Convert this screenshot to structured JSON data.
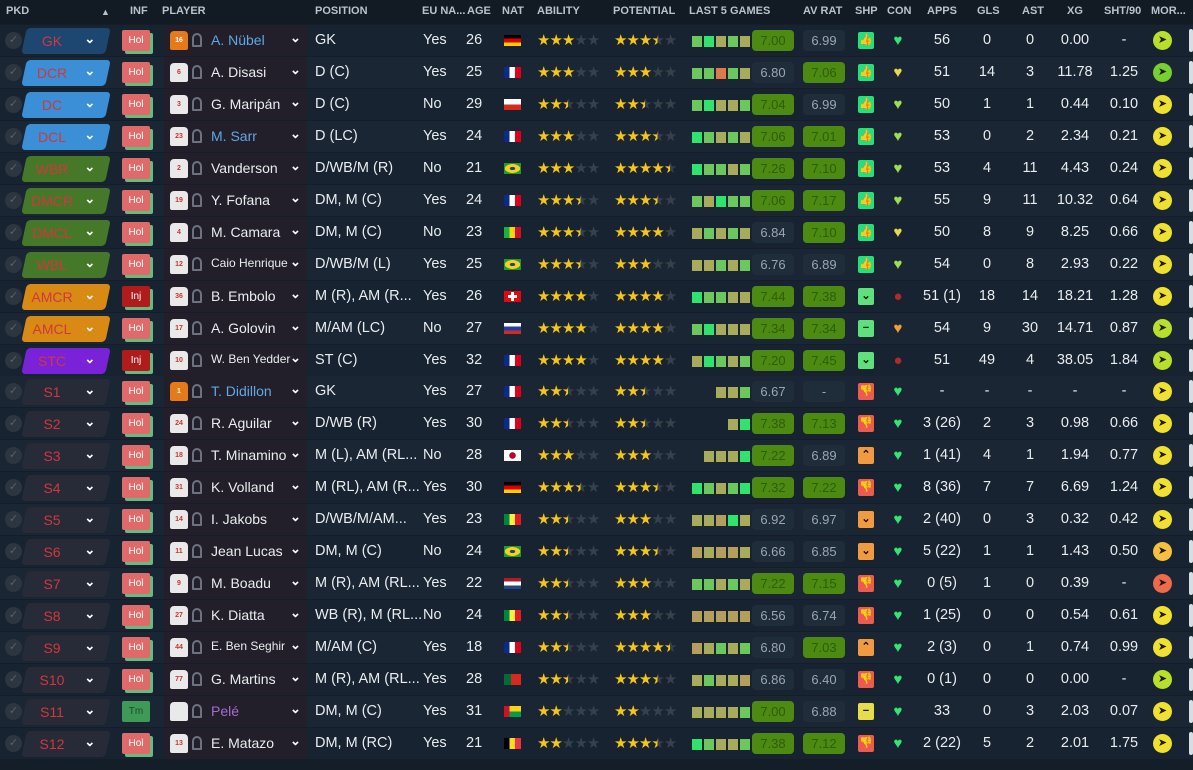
{
  "header": {
    "pkd": "PKD",
    "sort": "▲",
    "inf": "INF",
    "player": "PLAYER",
    "position": "POSITION",
    "eu": "EU NA...",
    "age": "AGE",
    "nat": "NAT",
    "ability": "ABILITY",
    "potential": "POTENTIAL",
    "last5": "LAST 5 GAMES",
    "avrat": "AV RAT",
    "shp": "SHP",
    "con": "CON",
    "apps": "APPS",
    "gls": "GLS",
    "ast": "AST",
    "xg": "XG",
    "sht90": "SHT/90",
    "mor": "MOR..."
  },
  "colors": {
    "gk": "#1d4670",
    "def": "#3a8fd6",
    "mid": "#46782a",
    "att": "#d88a14",
    "st": "#7a22d8",
    "sub": "#262b37",
    "hol": "#e06a6a",
    "inj": "#b01c1c",
    "tm": "#3f9a58",
    "name_default": "#e8ecef",
    "name_blue": "#5fa8e6",
    "name_purple": "#a56ad2"
  },
  "players": [
    {
      "pos": "GK",
      "pc": "gk",
      "inf": "Hol",
      "no": "16",
      "keeper": true,
      "name": "A. Nübel",
      "nc": "name_blue",
      "position": "GK",
      "eu": "Yes",
      "age": "26",
      "nat": "de",
      "ability": 3,
      "potential": 3.5,
      "last5": [
        "L",
        "G",
        "O",
        "L",
        "O"
      ],
      "form": "7.00",
      "avrat": "6.99",
      "shp": "thumb-up",
      "con": "green",
      "apps": "56",
      "gls": "0",
      "ast": "0",
      "xg": "0.00",
      "sht90": "-",
      "mor": "lime"
    },
    {
      "pos": "DCR",
      "pc": "def",
      "inf": "Hol",
      "no": "6",
      "name": "A. Disasi",
      "position": "D (C)",
      "eu": "Yes",
      "age": "25",
      "nat": "fr",
      "ability": 3,
      "potential": 3,
      "last5": [
        "L",
        "L",
        "R",
        "L",
        "O"
      ],
      "form": "6.80",
      "avrat": "7.06",
      "shp": "thumb-up",
      "con": "yellow",
      "apps": "51",
      "gls": "14",
      "ast": "3",
      "xg": "11.78",
      "sht90": "1.25",
      "mor": "green"
    },
    {
      "pos": "DC",
      "pc": "def",
      "inf": "Hol",
      "no": "3",
      "name": "G. Maripán",
      "position": "D (C)",
      "eu": "No",
      "age": "29",
      "nat": "cl",
      "ability": 2.5,
      "potential": 2.5,
      "last5": [
        "L",
        "G",
        "O",
        "O",
        "L"
      ],
      "form": "7.04",
      "avrat": "6.99",
      "shp": "thumb-up",
      "con": "lime",
      "apps": "50",
      "gls": "1",
      "ast": "1",
      "xg": "0.44",
      "sht90": "0.10",
      "mor": "yellow"
    },
    {
      "pos": "DCL",
      "pc": "def",
      "inf": "Hol",
      "no": "23",
      "name": "M. Sarr",
      "nc": "name_blue",
      "position": "D (LC)",
      "eu": "Yes",
      "age": "24",
      "nat": "fr",
      "ability": 3,
      "potential": 3.5,
      "last5": [
        "G",
        "L",
        "O",
        "L",
        "O"
      ],
      "form": "7.06",
      "avrat": "7.01",
      "shp": "thumb-up",
      "con": "lime",
      "apps": "53",
      "gls": "0",
      "ast": "2",
      "xg": "2.34",
      "sht90": "0.21",
      "mor": "yellow"
    },
    {
      "pos": "WBR",
      "pc": "mid",
      "inf": "Hol",
      "no": "2",
      "name": "Vanderson",
      "position": "D/WB/M (R)",
      "eu": "No",
      "age": "21",
      "nat": "br",
      "ability": 3,
      "potential": 4.5,
      "last5": [
        "G",
        "L",
        "L",
        "O",
        "L"
      ],
      "form": "7.26",
      "avrat": "7.10",
      "shp": "thumb-up",
      "con": "lime",
      "apps": "53",
      "gls": "4",
      "ast": "11",
      "xg": "4.43",
      "sht90": "0.24",
      "mor": "yellow"
    },
    {
      "pos": "DMCR",
      "pc": "mid",
      "inf": "Hol",
      "no": "19",
      "name": "Y. Fofana",
      "position": "DM, M (C)",
      "eu": "Yes",
      "age": "24",
      "nat": "fr",
      "ability": 3.5,
      "potential": 3.5,
      "last5": [
        "L",
        "O",
        "G",
        "L",
        "L"
      ],
      "form": "7.06",
      "avrat": "7.17",
      "shp": "thumb-up",
      "con": "lime",
      "apps": "55",
      "gls": "9",
      "ast": "11",
      "xg": "10.32",
      "sht90": "0.64",
      "mor": "yellow"
    },
    {
      "pos": "DMCL",
      "pc": "mid",
      "inf": "Hol",
      "no": "4",
      "name": "M. Camara",
      "position": "DM, M (C)",
      "eu": "No",
      "age": "23",
      "nat": "ml",
      "ability": 3.5,
      "potential": 4,
      "last5": [
        "O",
        "L",
        "O",
        "L",
        "O"
      ],
      "form": "6.84",
      "avrat": "7.10",
      "shp": "thumb-up",
      "con": "yellow",
      "apps": "50",
      "gls": "8",
      "ast": "9",
      "xg": "8.25",
      "sht90": "0.66",
      "mor": "yellow"
    },
    {
      "pos": "WBL",
      "pc": "mid",
      "inf": "Hol",
      "no": "12",
      "name": "Caio Henrique",
      "position": "D/WB/M (L)",
      "eu": "Yes",
      "age": "25",
      "nat": "br",
      "ability": 3.5,
      "potential": 3,
      "last5": [
        "O",
        "O",
        "L",
        "O",
        "L"
      ],
      "form": "6.76",
      "avrat": "6.89",
      "shp": "thumb-up",
      "con": "lime",
      "apps": "54",
      "gls": "0",
      "ast": "8",
      "xg": "2.93",
      "sht90": "0.22",
      "mor": "yellow"
    },
    {
      "pos": "AMCR",
      "pc": "att",
      "inf": "Inj",
      "no": "36",
      "name": "B. Embolo",
      "position": "M (R), AM (R...",
      "eu": "Yes",
      "age": "26",
      "nat": "ch",
      "ability": 4,
      "potential": 4,
      "last5": [
        "G",
        "L",
        "L",
        "O",
        "O"
      ],
      "form": "7.44",
      "avrat": "7.38",
      "shp": "chevron-down",
      "con": "injury",
      "apps": "51 (1)",
      "gls": "18",
      "ast": "14",
      "xg": "18.21",
      "sht90": "1.28",
      "mor": "yellow"
    },
    {
      "pos": "AMCL",
      "pc": "att",
      "inf": "Hol",
      "no": "17",
      "name": "A. Golovin",
      "position": "M/AM (LC)",
      "eu": "No",
      "age": "27",
      "nat": "ru",
      "ability": 4,
      "potential": 4,
      "last5": [
        "L",
        "G",
        "O",
        "O",
        "O"
      ],
      "form": "7.34",
      "avrat": "7.34",
      "shp": "minus",
      "con": "orange",
      "apps": "54",
      "gls": "9",
      "ast": "30",
      "xg": "14.71",
      "sht90": "0.87",
      "mor": "lime"
    },
    {
      "pos": "STC",
      "pc": "st",
      "inf": "Inj",
      "no": "10",
      "name": "W. Ben Yedder",
      "position": "ST (C)",
      "eu": "Yes",
      "age": "32",
      "nat": "fr",
      "ability": 4,
      "potential": 4,
      "last5": [
        "O",
        "G",
        "L",
        "O",
        "L"
      ],
      "form": "7.20",
      "avrat": "7.45",
      "shp": "chevron-down",
      "con": "injury",
      "apps": "51",
      "gls": "49",
      "ast": "4",
      "xg": "38.05",
      "sht90": "1.84",
      "mor": "lime"
    },
    {
      "pos": "S1",
      "pc": "sub",
      "inf": "Hol",
      "no": "1",
      "keeper": true,
      "name": "T. Didillon",
      "nc": "name_blue",
      "position": "GK",
      "eu": "Yes",
      "age": "27",
      "nat": "fr",
      "ability": 2.5,
      "potential": 2.5,
      "last5": [
        "",
        "",
        "O",
        "O",
        "L"
      ],
      "form": "6.67",
      "avrat": "-",
      "shp": "thumb-down",
      "con": "green",
      "apps": "-",
      "gls": "-",
      "ast": "-",
      "xg": "-",
      "sht90": "-",
      "mor": "yellow"
    },
    {
      "pos": "S2",
      "pc": "sub",
      "inf": "Hol",
      "no": "24",
      "name": "R. Aguilar",
      "position": "D/WB (R)",
      "eu": "Yes",
      "age": "30",
      "nat": "fr",
      "ability": 2.5,
      "potential": 2.5,
      "last5": [
        "",
        "",
        "",
        "O",
        "G"
      ],
      "form": "7.38",
      "avrat": "7.13",
      "shp": "thumb-down",
      "con": "green",
      "apps": "3 (26)",
      "gls": "2",
      "ast": "3",
      "xg": "0.98",
      "sht90": "0.66",
      "mor": "yellow"
    },
    {
      "pos": "S3",
      "pc": "sub",
      "inf": "Hol",
      "no": "18",
      "name": "T. Minamino",
      "position": "M (L), AM (RL...",
      "eu": "No",
      "age": "28",
      "nat": "jp",
      "ability": 3,
      "potential": 3,
      "last5": [
        "",
        "O",
        "O",
        "O",
        "G"
      ],
      "form": "7.22",
      "avrat": "6.89",
      "shp": "chevron-up",
      "con": "green",
      "apps": "1 (41)",
      "gls": "4",
      "ast": "1",
      "xg": "1.94",
      "sht90": "0.77",
      "mor": "yellow"
    },
    {
      "pos": "S4",
      "pc": "sub",
      "inf": "Hol",
      "no": "31",
      "name": "K. Volland",
      "position": "M (RL), AM (R...",
      "eu": "Yes",
      "age": "30",
      "nat": "de",
      "ability": 3.5,
      "potential": 3.5,
      "last5": [
        "G",
        "L",
        "O",
        "L",
        "G"
      ],
      "form": "7.32",
      "avrat": "7.22",
      "shp": "thumb-down",
      "con": "green",
      "apps": "8 (36)",
      "gls": "7",
      "ast": "7",
      "xg": "6.69",
      "sht90": "1.24",
      "mor": "yellow"
    },
    {
      "pos": "S5",
      "pc": "sub",
      "inf": "Hol",
      "no": "14",
      "name": "I. Jakobs",
      "position": "D/WB/M/AM...",
      "eu": "Yes",
      "age": "23",
      "nat": "sn",
      "ability": 2.5,
      "potential": 3,
      "last5": [
        "O",
        "O",
        "T",
        "G",
        "O"
      ],
      "form": "6.92",
      "avrat": "6.97",
      "shp": "chevron-down-orange",
      "con": "green",
      "apps": "2 (40)",
      "gls": "0",
      "ast": "3",
      "xg": "0.32",
      "sht90": "0.42",
      "mor": "yellow"
    },
    {
      "pos": "S6",
      "pc": "sub",
      "inf": "Hol",
      "no": "11",
      "name": "Jean Lucas",
      "position": "DM, M (C)",
      "eu": "No",
      "age": "24",
      "nat": "br",
      "ability": 2.5,
      "potential": 3.5,
      "last5": [
        "T",
        "O",
        "T",
        "T",
        "O"
      ],
      "form": "6.66",
      "avrat": "6.85",
      "shp": "chevron-down-orange",
      "con": "green",
      "apps": "5 (22)",
      "gls": "1",
      "ast": "1",
      "xg": "1.43",
      "sht90": "0.50",
      "mor": "amber"
    },
    {
      "pos": "S7",
      "pc": "sub",
      "inf": "Hol",
      "no": "9",
      "name": "M. Boadu",
      "position": "M (R), AM (RL...",
      "eu": "Yes",
      "age": "22",
      "nat": "nl",
      "ability": 2.5,
      "potential": 3,
      "last5": [
        "L",
        "L",
        "O",
        "L",
        "O"
      ],
      "form": "7.22",
      "avrat": "7.15",
      "shp": "thumb-down",
      "con": "green",
      "apps": "0 (5)",
      "gls": "1",
      "ast": "0",
      "xg": "0.39",
      "sht90": "-",
      "mor": "red"
    },
    {
      "pos": "S8",
      "pc": "sub",
      "inf": "Hol",
      "no": "27",
      "name": "K. Diatta",
      "position": "WB (R), M (RL...",
      "eu": "No",
      "age": "24",
      "nat": "sn",
      "ability": 2.5,
      "potential": 3,
      "last5": [
        "T",
        "T",
        "T",
        "T",
        "T"
      ],
      "form": "6.56",
      "avrat": "6.74",
      "shp": "thumb-down",
      "con": "green",
      "apps": "1 (25)",
      "gls": "0",
      "ast": "0",
      "xg": "0.54",
      "sht90": "0.61",
      "mor": "yellow"
    },
    {
      "pos": "S9",
      "pc": "sub",
      "inf": "Hol",
      "no": "44",
      "name": "E. Ben Seghir",
      "position": "M/AM (C)",
      "eu": "Yes",
      "age": "18",
      "nat": "fr",
      "ability": 2.5,
      "potential": 4.5,
      "last5": [
        "T",
        "O",
        "L",
        "O",
        "L"
      ],
      "form": "6.80",
      "avrat": "7.03",
      "shp": "chevron-up",
      "con": "green",
      "apps": "2 (3)",
      "gls": "0",
      "ast": "1",
      "xg": "0.74",
      "sht90": "0.99",
      "mor": "yellow"
    },
    {
      "pos": "S10",
      "pc": "sub",
      "inf": "Hol",
      "no": "77",
      "name": "G. Martins",
      "position": "M (R), AM (RL...",
      "eu": "Yes",
      "age": "28",
      "nat": "pt",
      "ability": 2.5,
      "potential": 3.5,
      "last5": [
        "O",
        "L",
        "O",
        "O",
        "T"
      ],
      "form": "6.86",
      "avrat": "6.40",
      "shp": "thumb-down",
      "con": "green",
      "apps": "0 (1)",
      "gls": "0",
      "ast": "0",
      "xg": "0.00",
      "sht90": "-",
      "mor": "lime"
    },
    {
      "pos": "S11",
      "pc": "sub",
      "inf": "Tm",
      "no": "",
      "name": "Pelé",
      "nc": "name_purple",
      "position": "DM, M (C)",
      "eu": "Yes",
      "age": "31",
      "nat": "gw",
      "ability": 2,
      "potential": 2,
      "last5": [
        "O",
        "O",
        "O",
        "O",
        "L"
      ],
      "form": "7.00",
      "avrat": "6.88",
      "shp": "minus-yellow",
      "con": "green",
      "apps": "33",
      "gls": "0",
      "ast": "3",
      "xg": "2.03",
      "sht90": "0.07",
      "mor": "yellow"
    },
    {
      "pos": "S12",
      "pc": "sub",
      "inf": "Hol",
      "no": "13",
      "name": "E. Matazo",
      "position": "DM, M (RC)",
      "eu": "Yes",
      "age": "21",
      "nat": "be",
      "ability": 2,
      "potential": 3.5,
      "last5": [
        "G",
        "L",
        "O",
        "O",
        "L"
      ],
      "form": "7.38",
      "avrat": "7.12",
      "shp": "thumb-down",
      "con": "green",
      "apps": "2 (22)",
      "gls": "5",
      "ast": "2",
      "xg": "2.01",
      "sht90": "1.75",
      "mor": "yellow"
    }
  ]
}
